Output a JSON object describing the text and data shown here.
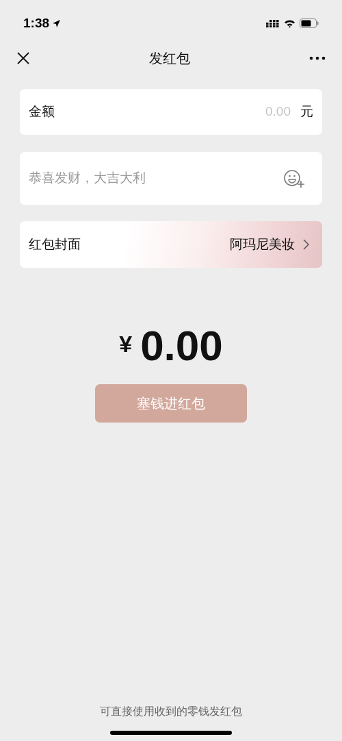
{
  "status_bar": {
    "time": "1:38"
  },
  "nav": {
    "title": "发红包"
  },
  "amount_field": {
    "label": "金额",
    "placeholder": "0.00",
    "unit": "元"
  },
  "message_field": {
    "placeholder": "恭喜发财，大吉大利"
  },
  "cover_row": {
    "label": "红包封面",
    "value": "阿玛尼美妆"
  },
  "total": {
    "currency": "¥",
    "amount": "0.00"
  },
  "submit_button": {
    "label": "塞钱进红包",
    "disabled": true
  },
  "footer_note": "可直接使用收到的零钱发红包"
}
